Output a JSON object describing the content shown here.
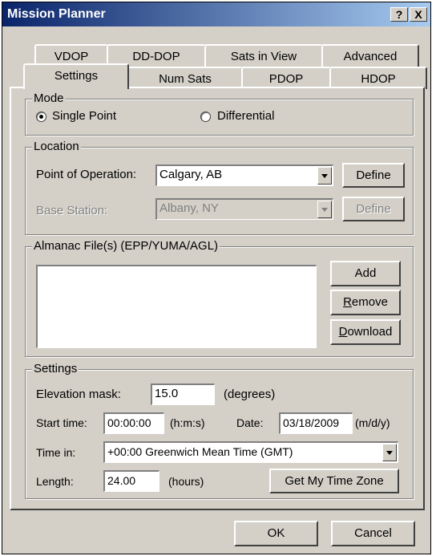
{
  "window": {
    "title": "Mission Planner",
    "help_glyph": "?",
    "close_glyph": "X"
  },
  "tabs_back": [
    "VDOP",
    "DD-DOP",
    "Sats in View",
    "Advanced"
  ],
  "tabs_front": [
    "Settings",
    "Num Sats",
    "PDOP",
    "HDOP"
  ],
  "mode": {
    "label": "Mode",
    "option1": "Single Point",
    "option2": "Differential",
    "selected": "Single Point"
  },
  "location": {
    "label": "Location",
    "point_label": "Point of Operation:",
    "point_value": "Calgary, AB",
    "base_label": "Base Station:",
    "base_value": "Albany, NY",
    "define_label": "Define"
  },
  "almanac": {
    "label": "Almanac File(s) (EPP/YUMA/AGL)",
    "add_label": "Add",
    "remove_prefix": "R",
    "remove_rest": "emove",
    "download_prefix": "D",
    "download_rest": "ownload"
  },
  "settings": {
    "label": "Settings",
    "elev_label": "Elevation mask:",
    "elev_value": "15.0",
    "elev_unit": "(degrees)",
    "start_label": "Start time:",
    "start_value": "00:00:00",
    "start_unit": "(h:m:s)",
    "date_label": "Date:",
    "date_value": "03/18/2009",
    "date_unit": "(m/d/y)",
    "timein_label": "Time in:",
    "timein_value": "+00:00  Greenwich Mean Time (GMT)",
    "length_label": "Length:",
    "length_value": "24.00",
    "length_unit": "(hours)",
    "tz_button": "Get My Time Zone"
  },
  "buttons": {
    "ok": "OK",
    "cancel": "Cancel"
  }
}
